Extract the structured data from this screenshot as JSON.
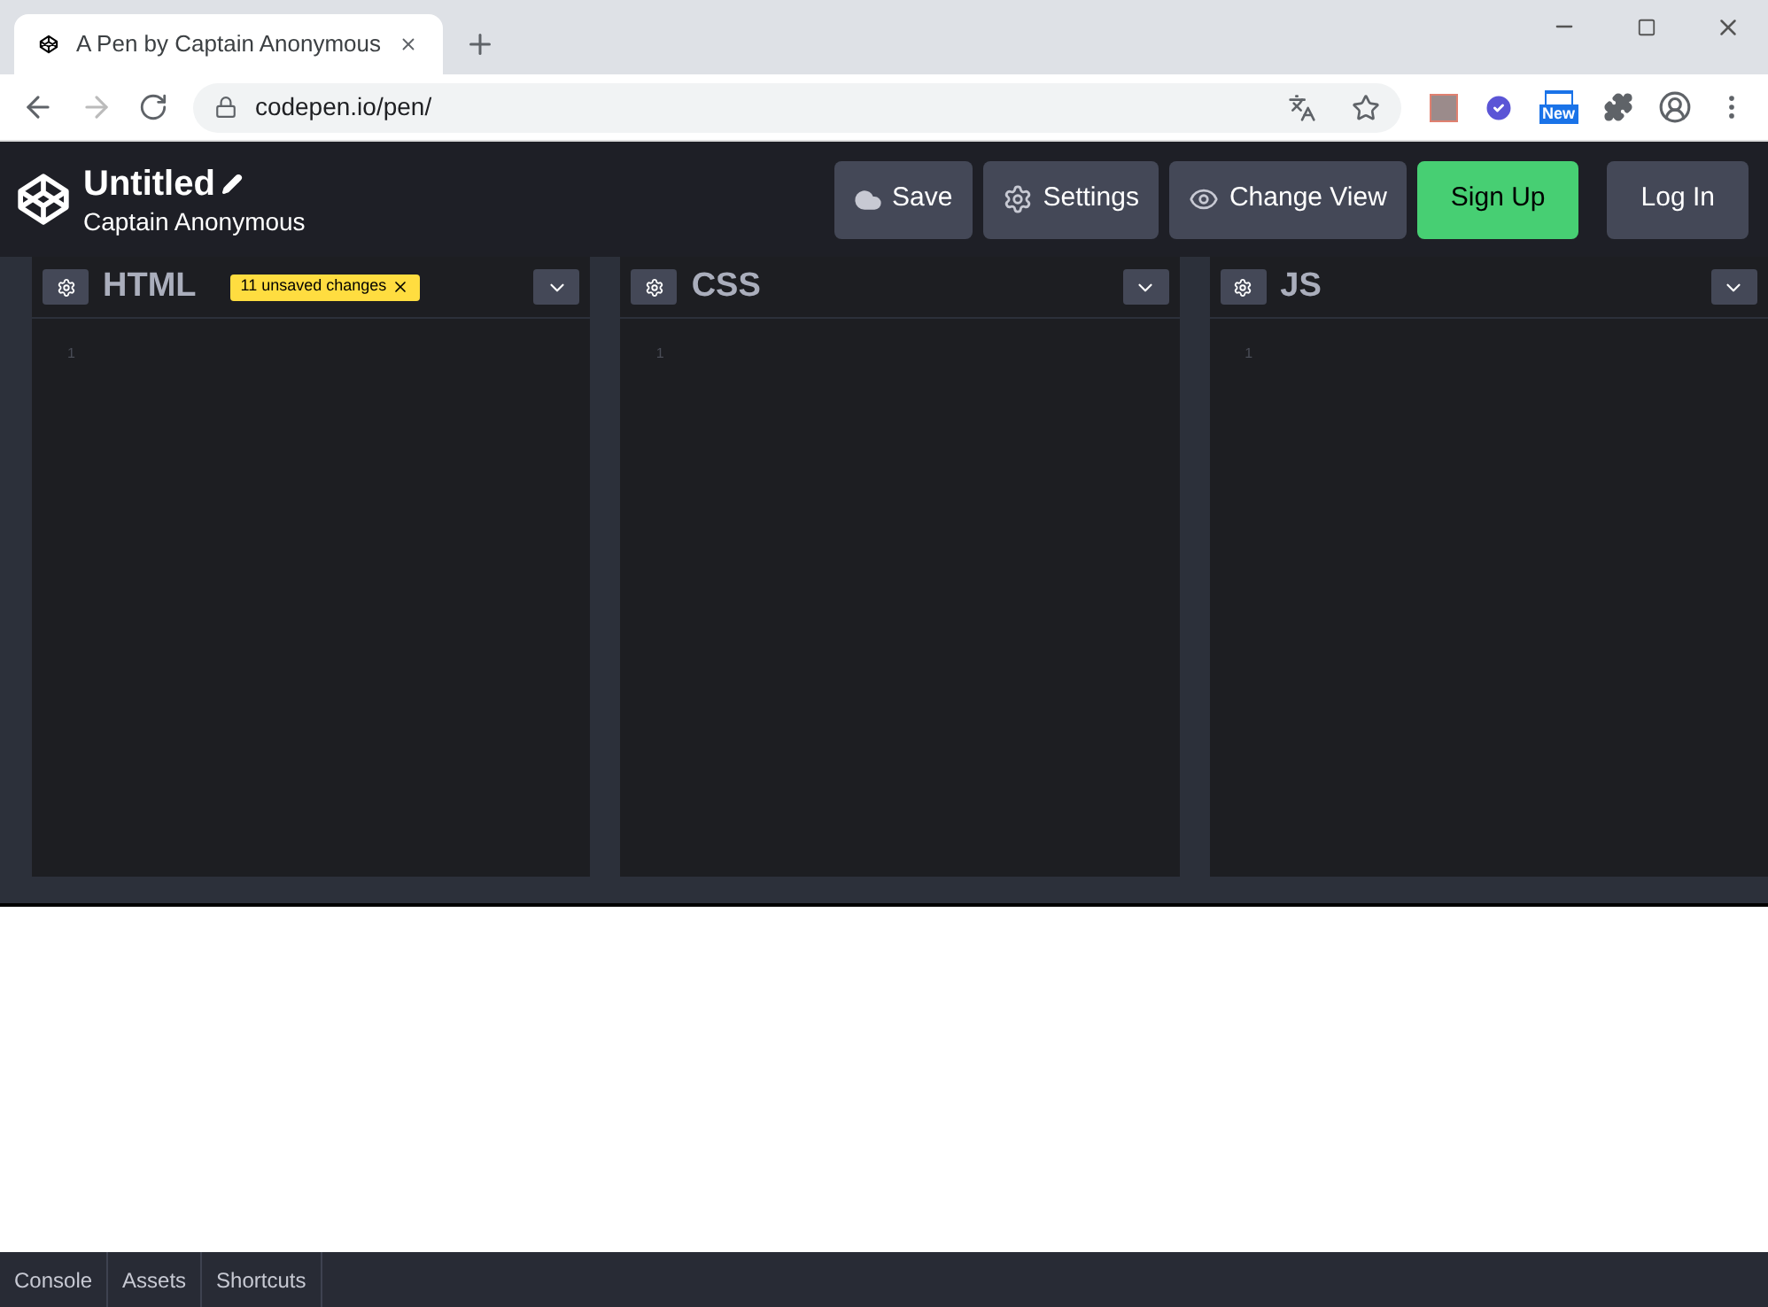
{
  "browser": {
    "tab_title": "A Pen by Captain Anonymous",
    "url": "codepen.io/pen/",
    "extension_badge": "New"
  },
  "header": {
    "title": "Untitled",
    "author": "Captain Anonymous",
    "buttons": [
      {
        "kind": "save",
        "label": "Save"
      },
      {
        "kind": "settings",
        "label": "Settings"
      },
      {
        "kind": "view",
        "label": "Change View"
      },
      {
        "kind": "signup",
        "label": "Sign Up"
      },
      {
        "kind": "login",
        "label": "Log In"
      }
    ]
  },
  "editors": [
    {
      "name": "HTML",
      "badge": "11 unsaved changes",
      "line": "1"
    },
    {
      "name": "CSS",
      "line": "1"
    },
    {
      "name": "JS",
      "line": "1"
    }
  ],
  "footer": {
    "tabs": [
      "Console",
      "Assets",
      "Shortcuts"
    ]
  }
}
